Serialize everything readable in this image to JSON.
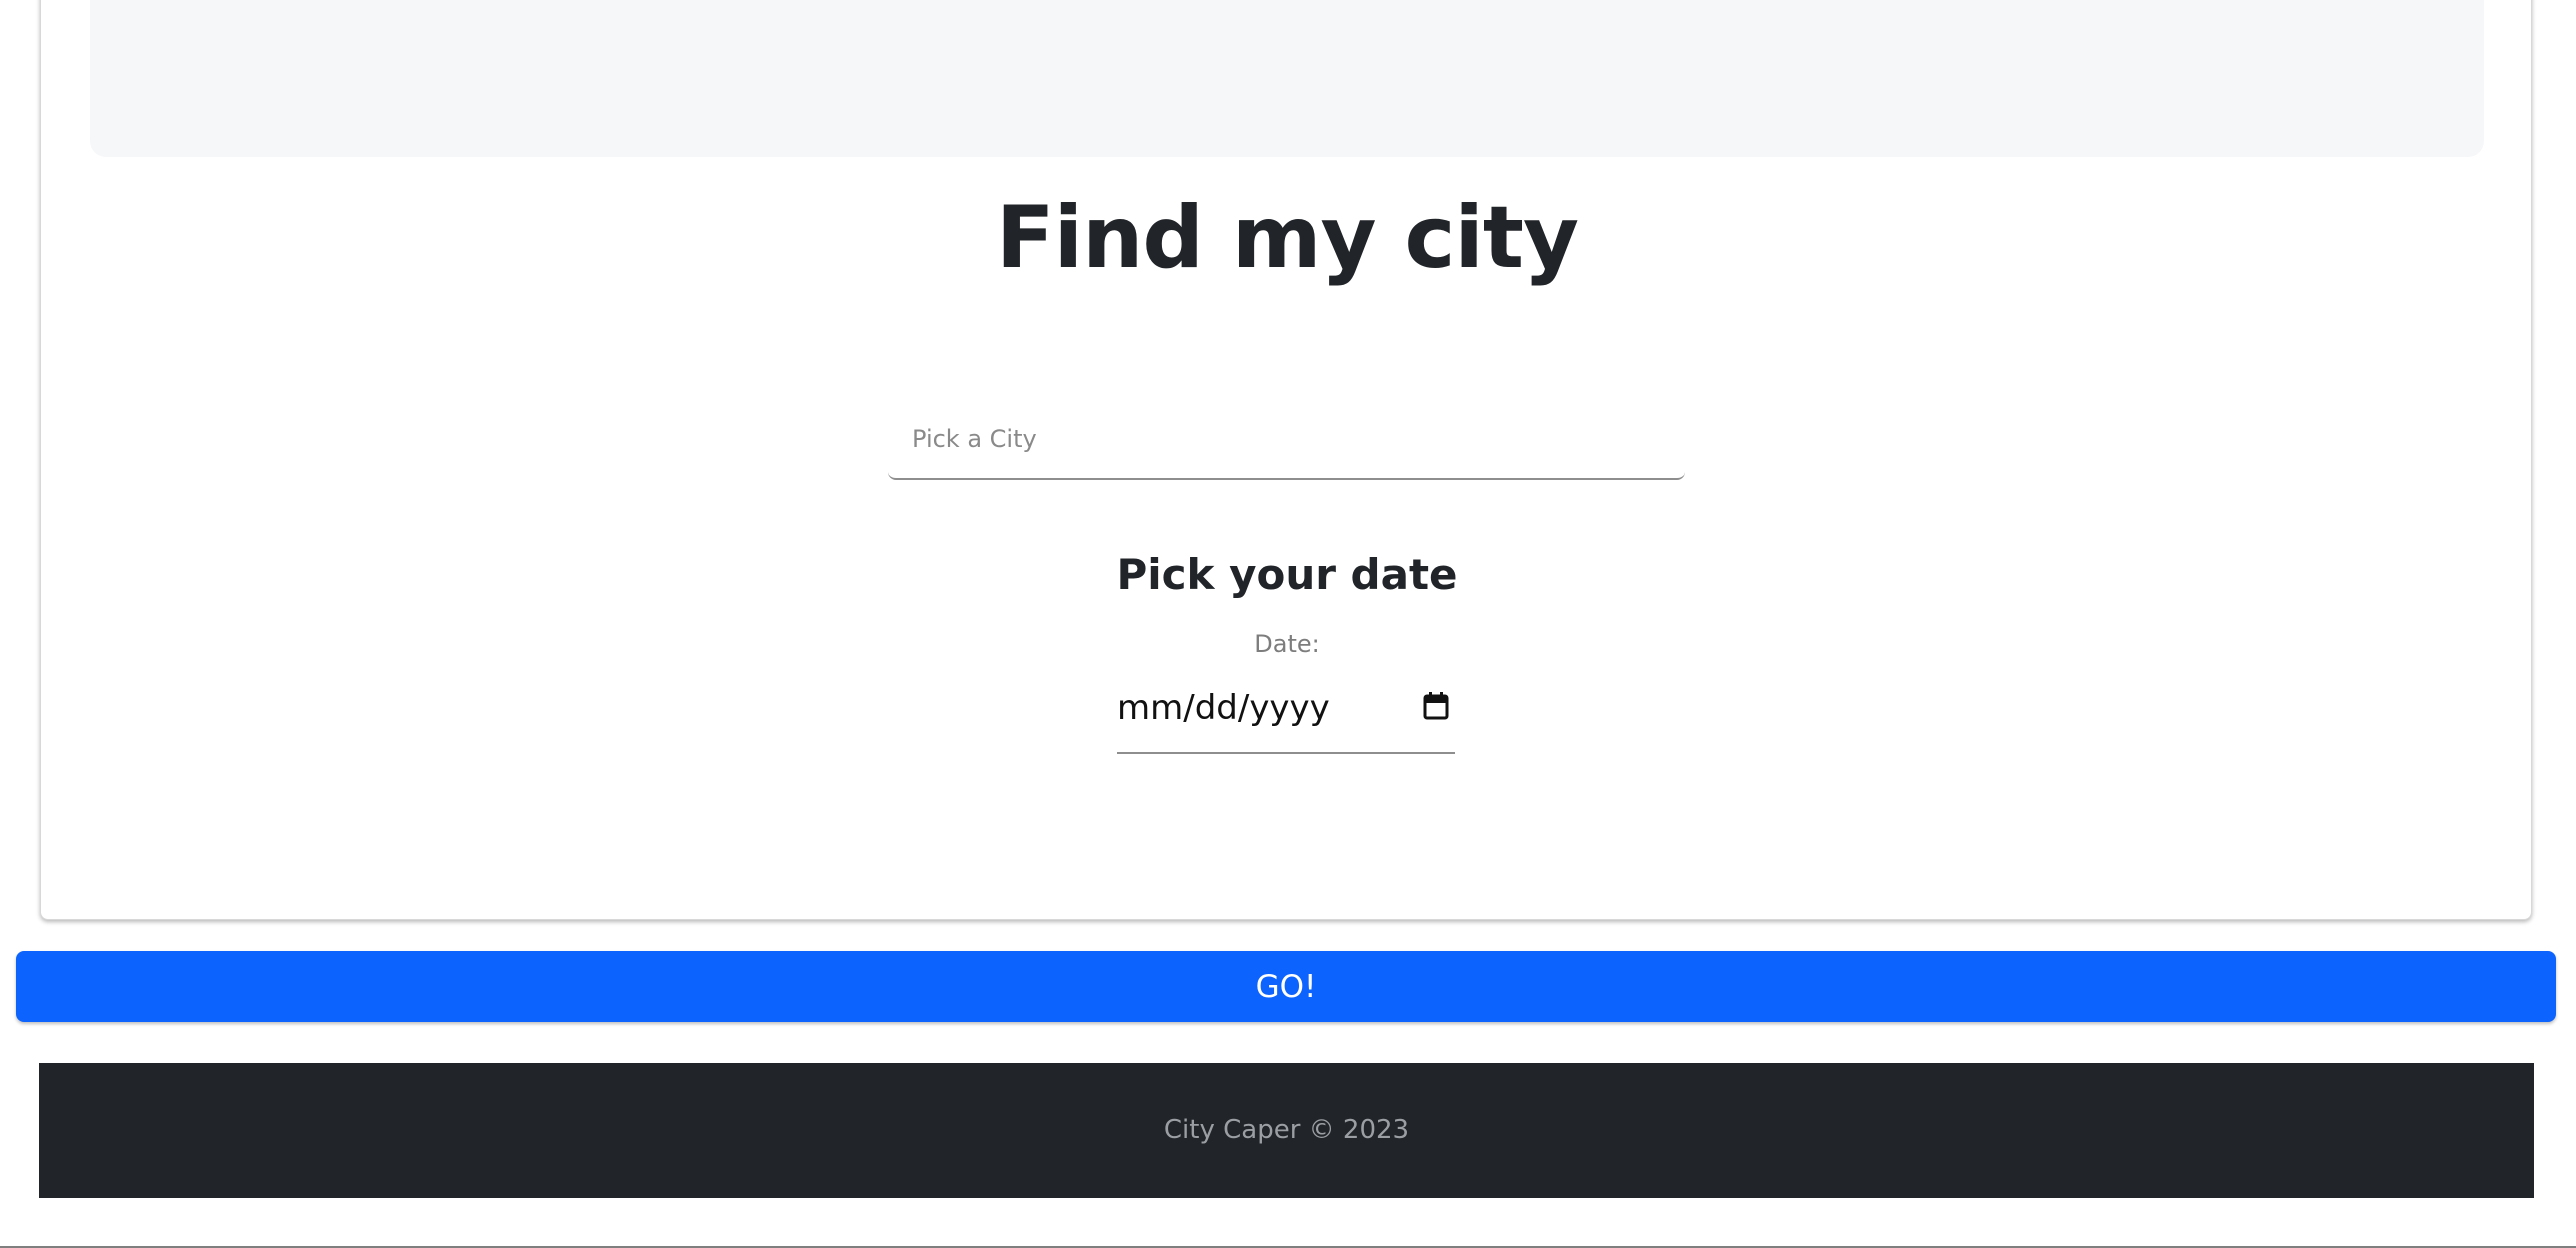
{
  "main": {
    "title": "Find my city",
    "city_input": {
      "placeholder": "Pick a City",
      "value": ""
    },
    "date_section": {
      "heading": "Pick your date",
      "label": "Date:",
      "value": "mm/dd/yyyy",
      "icon": "calendar-icon"
    }
  },
  "actions": {
    "go_label": "GO!"
  },
  "footer": {
    "text": "City Caper © 2023"
  },
  "colors": {
    "primary": "#0d63fd",
    "footer_bg": "#212529",
    "banner_bg": "#f6f7f9",
    "title_text": "#212529"
  }
}
